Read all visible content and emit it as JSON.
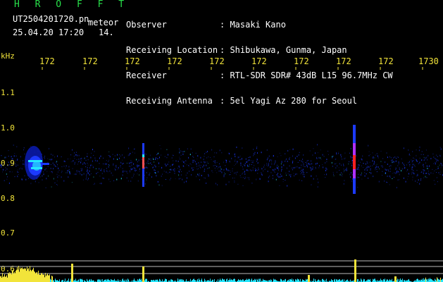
{
  "header": {
    "app_name": "H R O F F T",
    "filename": "UT2504201720.pn",
    "mode": "meteor",
    "datetime": "25.04.20 17:20",
    "number": "14.",
    "labels": [
      "Observer",
      "Receiving Location",
      "Receiver",
      "Receiving Antenna"
    ],
    "values": [
      ": Masaki Kano",
      ": Shibukawa, Gunma, Japan",
      ": RTL-SDR SDR# 43dB L15 96.7MHz CW",
      ": 5el Yagi Az 280 for Seoul"
    ]
  },
  "axes": {
    "y_unit": "kHz",
    "x_ticks": [
      "172",
      "172",
      "172",
      "172",
      "172",
      "172",
      "172",
      "172",
      "172",
      "1730"
    ],
    "y_ticks": [
      "1.1",
      "1.0",
      "0.9",
      "0.8",
      "0.7",
      "0.6"
    ]
  },
  "colors": {
    "header_green": "#28e04a",
    "axis_yellow": "#f2e43a",
    "signal_blue": "#1c3aff",
    "signal_cyan": "#24e6ff",
    "signal_red": "#ff2020",
    "level_yellow": "#f2e43a"
  }
}
